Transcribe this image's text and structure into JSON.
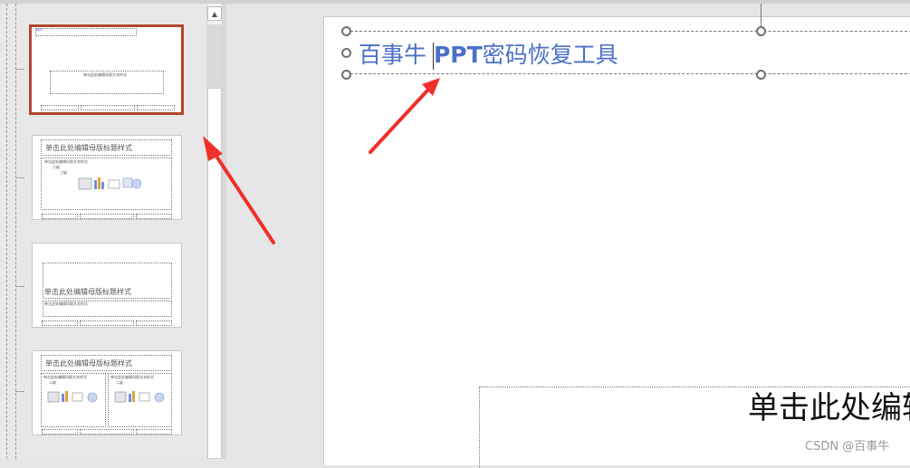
{
  "slide": {
    "title_part1": "百事牛 ",
    "title_bold": "PPT",
    "title_part2": "密码恢复工具",
    "body_placeholder": "单击此处编辑"
  },
  "thumbnails": {
    "layout_title": "单击此处编辑母版标题样式",
    "layout_body": "单击此处编辑母版文本样式",
    "level2": "二级",
    "level3": "三级"
  },
  "watermark": "CSDN @百事牛",
  "colors": {
    "selection_border": "#b2472c",
    "title_text": "#4a70c8",
    "arrow": "#f0302a"
  },
  "scrollbar": {
    "up_arrow": "▲"
  }
}
